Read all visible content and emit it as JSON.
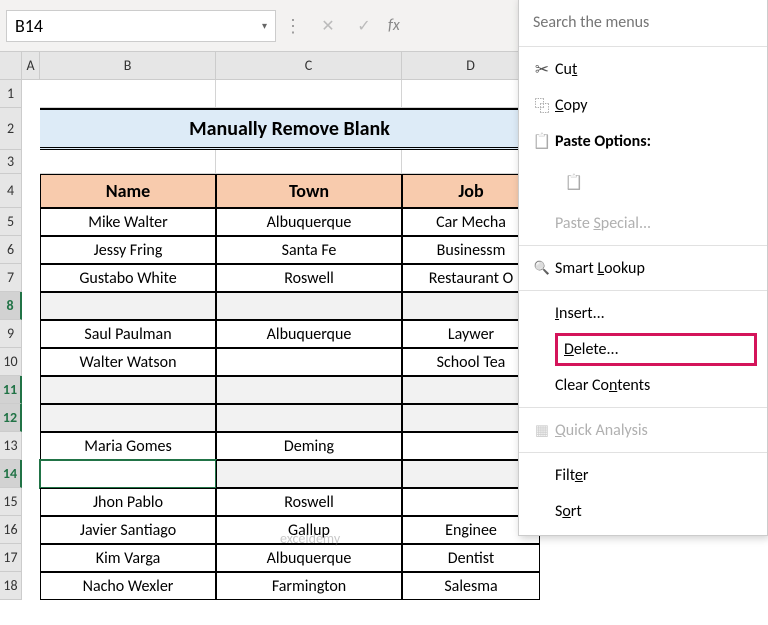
{
  "formula_bar": {
    "cell_ref": "B14",
    "fx_label": "fx"
  },
  "columns": [
    "A",
    "B",
    "C",
    "D"
  ],
  "row_numbers": [
    "1",
    "2",
    "3",
    "4",
    "5",
    "6",
    "7",
    "8",
    "9",
    "10",
    "11",
    "12",
    "13",
    "14",
    "15",
    "16",
    "17",
    "18"
  ],
  "selected_rows": [
    "8",
    "11",
    "12",
    "14"
  ],
  "title": "Manually Remove Blank",
  "table": {
    "headers": [
      "Name",
      "Town",
      "Job"
    ],
    "rows": [
      {
        "name": "Mike Walter",
        "town": "Albuquerque",
        "job": "Car Mecha"
      },
      {
        "name": "Jessy Fring",
        "town": "Santa Fe",
        "job": "Businessm"
      },
      {
        "name": "Gustabo White",
        "town": "Roswell",
        "job": "Restaurant O"
      },
      {
        "name": "",
        "town": "",
        "job": ""
      },
      {
        "name": "Saul Paulman",
        "town": "Albuquerque",
        "job": "Laywer"
      },
      {
        "name": "Walter Watson",
        "town": "",
        "job": "School Tea"
      },
      {
        "name": "",
        "town": "",
        "job": ""
      },
      {
        "name": "",
        "town": "",
        "job": ""
      },
      {
        "name": "Maria Gomes",
        "town": "Deming",
        "job": ""
      },
      {
        "name": "",
        "town": "",
        "job": ""
      },
      {
        "name": "Jhon Pablo",
        "town": "Roswell",
        "job": ""
      },
      {
        "name": "Javier Santiago",
        "town": "Gallup",
        "job": "Enginee"
      },
      {
        "name": "Kim Varga",
        "town": "Albuquerque",
        "job": "Dentist"
      },
      {
        "name": "Nacho Wexler",
        "town": "Farmington",
        "job": "Salesma"
      }
    ]
  },
  "context_menu": {
    "search_placeholder": "Search the menus",
    "items": {
      "cut": "Cut",
      "copy": "Copy",
      "paste_options": "Paste Options:",
      "paste_special": "Paste Special...",
      "smart_lookup": "Smart Lookup",
      "insert": "Insert...",
      "delete": "Delete...",
      "clear_contents": "Clear Contents",
      "quick_analysis": "Quick Analysis",
      "filter": "Filter",
      "sort": "Sort"
    }
  },
  "watermark": "exceldemy"
}
